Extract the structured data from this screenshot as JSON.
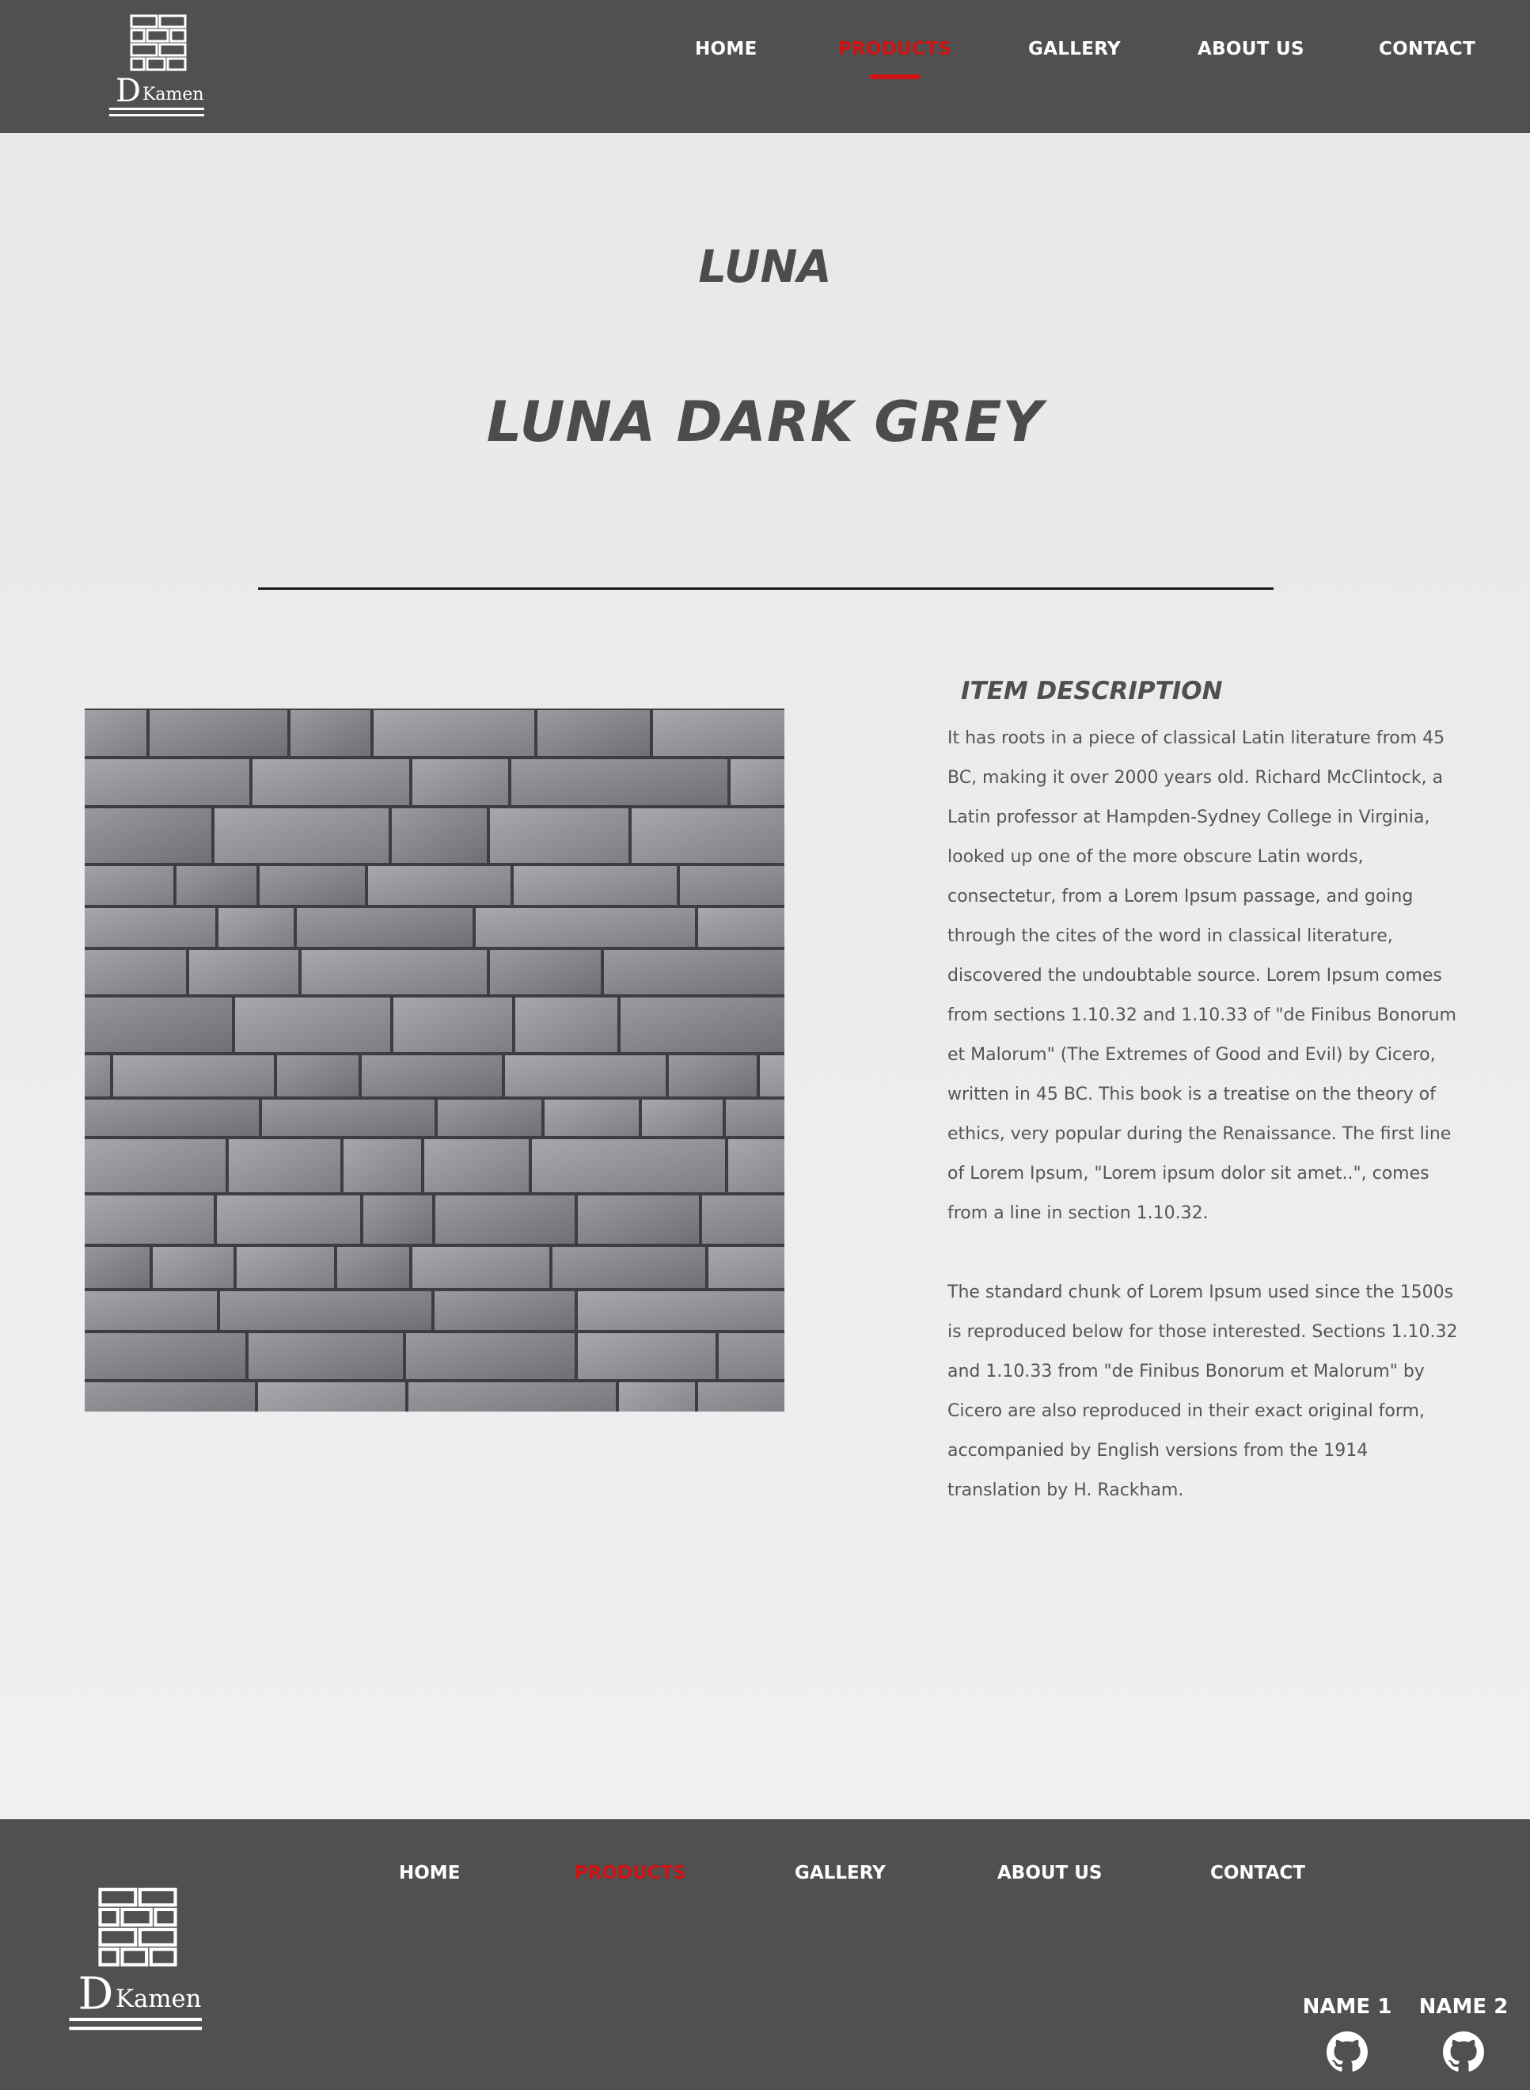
{
  "brand": {
    "logo_letter": "D",
    "logo_word": "Kamen"
  },
  "nav": {
    "items": [
      {
        "label": "HOME",
        "active": false
      },
      {
        "label": "PRODUCTS",
        "active": true
      },
      {
        "label": "GALLERY",
        "active": false
      },
      {
        "label": "ABOUT US",
        "active": false
      },
      {
        "label": "CONTACT",
        "active": false
      }
    ]
  },
  "product": {
    "collection": "LUNA",
    "name": "LUNA DARK GREY",
    "image_alt": "stone-wall-cladding",
    "description_heading": "ITEM DESCRIPTION",
    "description_p1": "It has roots in a piece of classical Latin literature from 45 BC, making it over 2000 years old. Richard McClintock, a Latin professor at Hampden-Sydney College in Virginia, looked up one of the more obscure Latin words, consectetur, from a Lorem Ipsum passage, and going through the cites of the word in classical literature, discovered the undoubtable source. Lorem Ipsum comes from sections 1.10.32 and 1.10.33 of \"de Finibus Bonorum et Malorum\" (The Extremes of Good and Evil) by Cicero, written in 45 BC. This book is a treatise on the theory of ethics, very popular during the Renaissance. The first line of Lorem Ipsum, \"Lorem ipsum dolor sit amet..\", comes from a line in section 1.10.32.",
    "description_p2": "The standard chunk of Lorem Ipsum used since the 1500s is reproduced below for those interested. Sections 1.10.32 and 1.10.33 from \"de Finibus Bonorum et Malorum\" by Cicero are also reproduced in their exact original form, accompanied by English versions from the 1914 translation by H. Rackham."
  },
  "footer": {
    "nav": [
      {
        "label": "HOME",
        "active": false
      },
      {
        "label": "PRODUCTS",
        "active": true
      },
      {
        "label": "GALLERY",
        "active": false
      },
      {
        "label": "ABOUT US",
        "active": false
      },
      {
        "label": "CONTACT",
        "active": false
      }
    ],
    "members": [
      {
        "name": "NAME 1",
        "icon": "github-icon"
      },
      {
        "name": "NAME 2",
        "icon": "github-icon"
      }
    ]
  },
  "colors": {
    "header_bg": "#505050",
    "accent": "#d01212",
    "text": "#4f4f4f"
  }
}
